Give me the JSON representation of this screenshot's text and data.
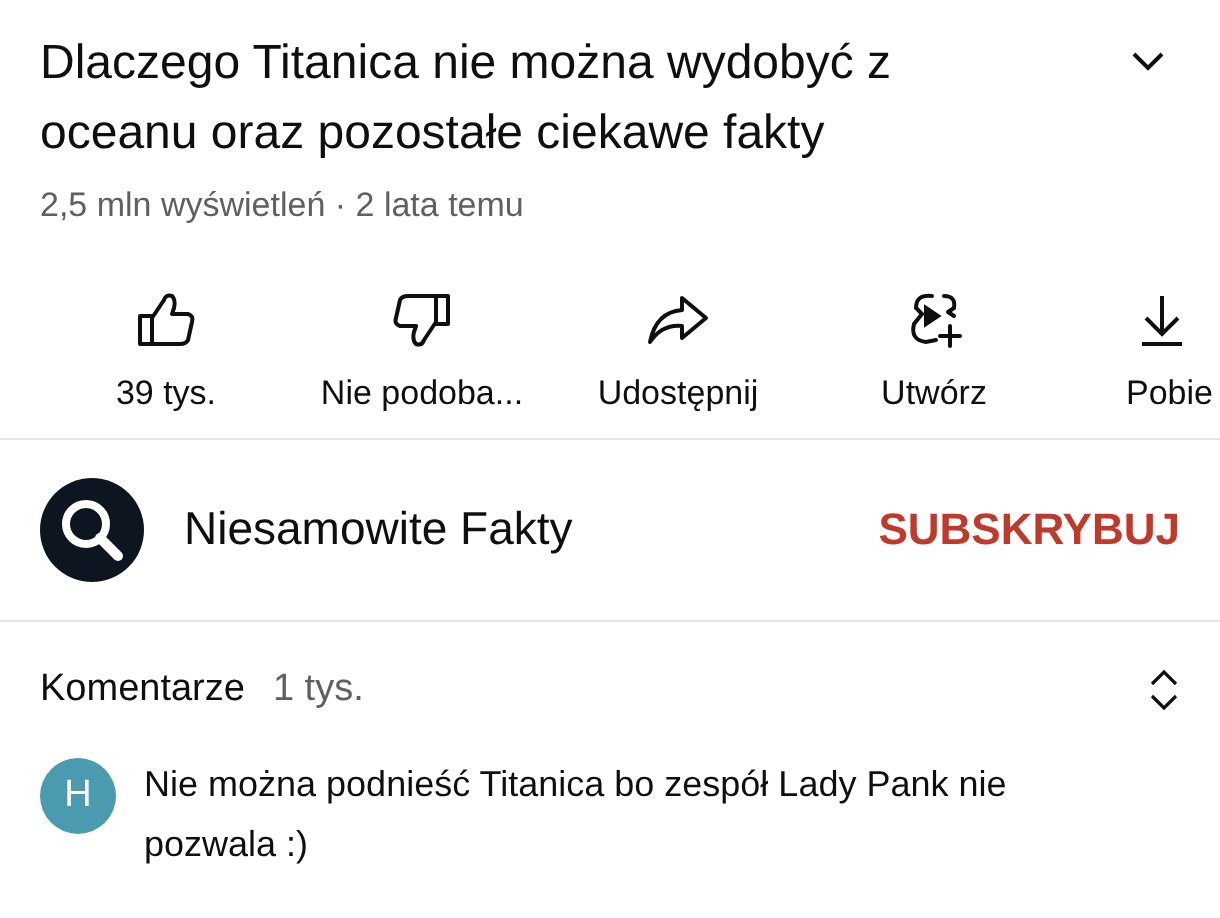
{
  "video": {
    "title": "Dlaczego Titanica nie można wydobyć z oceanu oraz pozostałe ciekawe fakty",
    "meta": "2,5 mln wyświetleń · 2 lata temu"
  },
  "actions": [
    {
      "kind": "like",
      "label": "39 tys."
    },
    {
      "kind": "dislike",
      "label": "Nie podoba..."
    },
    {
      "kind": "share",
      "label": "Udostępnij"
    },
    {
      "kind": "create",
      "label": "Utwórz"
    },
    {
      "kind": "download",
      "label": "Pobie"
    }
  ],
  "channel": {
    "name": "Niesamowite Fakty",
    "subscribe": "SUBSKRYBUJ"
  },
  "comments": {
    "title": "Komentarze",
    "count": "1 tys.",
    "top_comment": {
      "avatar_letter": "H",
      "text": "Nie można podnieść Titanica bo zespół Lady Pank nie pozwala :)"
    }
  }
}
